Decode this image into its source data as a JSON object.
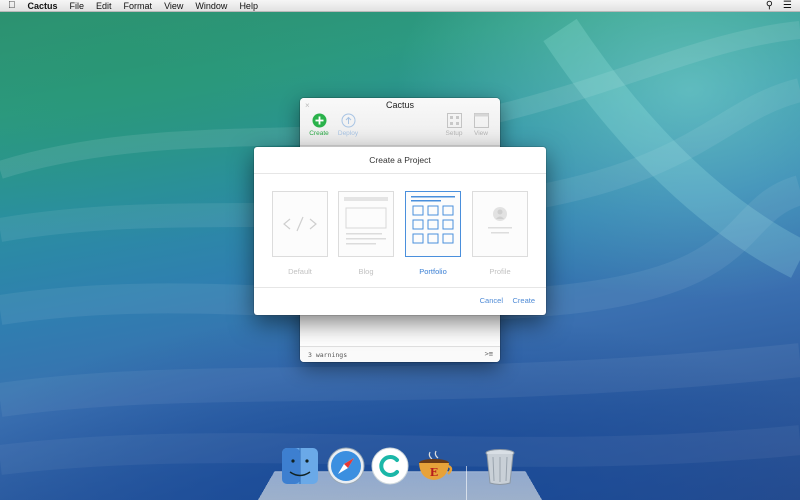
{
  "menubar": {
    "app_name": "Cactus",
    "items": [
      "File",
      "Edit",
      "Format",
      "View",
      "Window",
      "Help"
    ]
  },
  "main_window": {
    "title": "Cactus",
    "toolbar": {
      "create_label": "Create",
      "deploy_label": "Deploy",
      "setup_label": "Setup",
      "view_label": "View"
    },
    "footer_status": "3 warnings"
  },
  "sheet": {
    "title": "Create a Project",
    "templates": [
      {
        "name": "Default",
        "selected": false
      },
      {
        "name": "Blog",
        "selected": false
      },
      {
        "name": "Portfolio",
        "selected": true
      },
      {
        "name": "Profile",
        "selected": false
      }
    ],
    "cancel_label": "Cancel",
    "create_label": "Create"
  },
  "dock": {
    "items": [
      "Finder",
      "Safari",
      "Cactus",
      "Coffee",
      "Trash"
    ]
  },
  "colors": {
    "accent_green": "#2aa845",
    "accent_blue": "#3a7fd4",
    "selected_border": "#4a8fdc"
  },
  "icons": {
    "menubar_left": "apple-icon",
    "menubar_search": "search-icon",
    "menubar_list": "notification-list-icon"
  }
}
